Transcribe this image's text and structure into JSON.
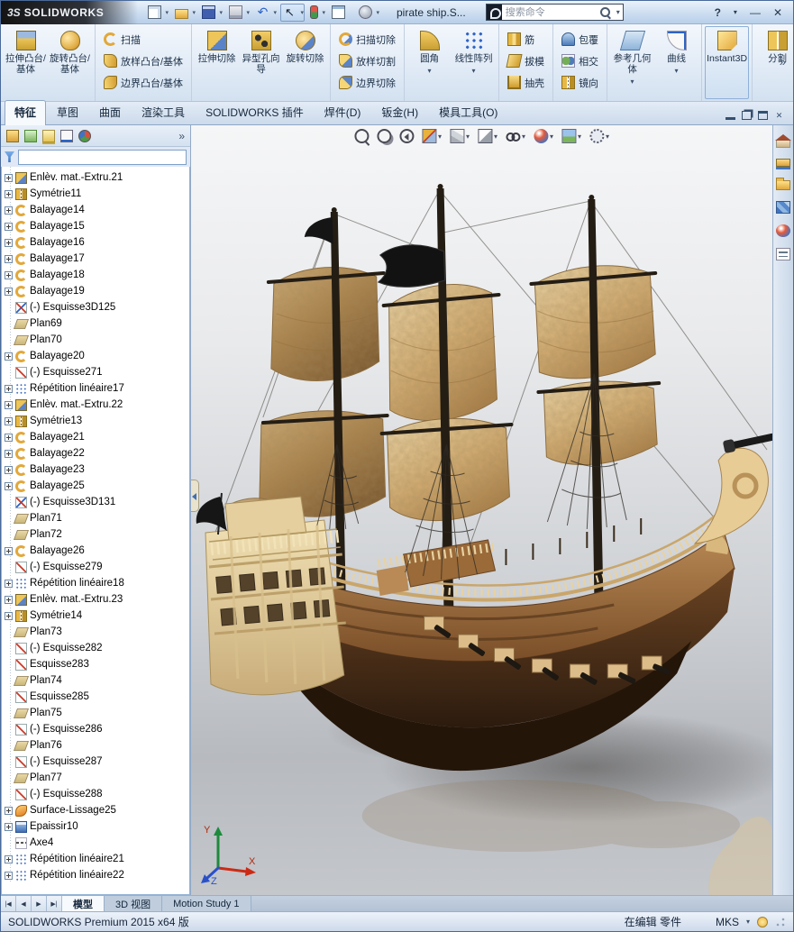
{
  "window": {
    "logo_mark": "3S",
    "logo_text": "SOLIDWORKS",
    "doc_name": "pirate ship.S...",
    "search_placeholder": "搜索命令",
    "help": "?",
    "help_chevron": "▾",
    "minimize": "—",
    "close": "✕"
  },
  "titlebar": {
    "tools": [
      {
        "name": "new-document-icon",
        "icon": "newdoc",
        "dropdown": true
      },
      {
        "name": "open-icon",
        "icon": "open",
        "dropdown": true
      },
      {
        "name": "save-icon",
        "icon": "save",
        "dropdown": true
      },
      {
        "name": "print-icon",
        "icon": "print",
        "dropdown": true
      },
      {
        "name": "undo-icon",
        "icon": "undo",
        "dropdown": true
      },
      {
        "name": "select-icon",
        "icon": "select",
        "dropdown": true,
        "active": true
      },
      {
        "name": "rebuild-icon",
        "icon": "rebuild",
        "dropdown": true
      },
      {
        "name": "file-properties-icon",
        "icon": "fileprops"
      },
      {
        "name": "options-icon",
        "icon": "options",
        "dropdown": true
      }
    ]
  },
  "ribbon": {
    "overflow": "»",
    "sections": [
      {
        "layout": "large",
        "items": [
          {
            "label": "拉伸凸台/基体",
            "icon": "extrude"
          },
          {
            "label": "旋转凸台/基体",
            "icon": "revolve"
          }
        ]
      },
      {
        "layout": "stack",
        "items": [
          {
            "label": "扫描",
            "icon": "sweep"
          },
          {
            "label": "放样凸台/基体",
            "icon": "loft"
          },
          {
            "label": "边界凸台/基体",
            "icon": "boundary"
          }
        ]
      },
      {
        "layout": "large",
        "items": [
          {
            "label": "拉伸切除",
            "icon": "cut-extrude"
          },
          {
            "label": "异型孔向导",
            "icon": "holewiz"
          },
          {
            "label": "旋转切除",
            "icon": "cut-revolve"
          }
        ]
      },
      {
        "layout": "stack",
        "items": [
          {
            "label": "扫描切除",
            "icon": "cut-sweep"
          },
          {
            "label": "放样切割",
            "icon": "cut-loft"
          },
          {
            "label": "边界切除",
            "icon": "cut-boundary"
          }
        ]
      },
      {
        "layout": "large",
        "items": [
          {
            "label": "圆角",
            "icon": "fillet",
            "dropdown": true
          },
          {
            "label": "线性阵列",
            "icon": "linpat",
            "dropdown": true
          }
        ]
      },
      {
        "layout": "stack",
        "items": [
          {
            "label": "筋",
            "icon": "rib"
          },
          {
            "label": "拔模",
            "icon": "draft"
          },
          {
            "label": "抽壳",
            "icon": "shell"
          }
        ]
      },
      {
        "layout": "stack",
        "items": [
          {
            "label": "包覆",
            "icon": "wrap"
          },
          {
            "label": "相交",
            "icon": "intersect"
          },
          {
            "label": "镜向",
            "icon": "mirror-f"
          }
        ]
      },
      {
        "layout": "large",
        "items": [
          {
            "label": "参考几何体",
            "icon": "refgeo",
            "dropdown": true
          },
          {
            "label": "曲线",
            "icon": "curves",
            "dropdown": true
          }
        ]
      },
      {
        "layout": "large",
        "items": [
          {
            "label": "Instant3D",
            "icon": "instant3d",
            "active": true
          }
        ]
      },
      {
        "layout": "large",
        "items": [
          {
            "label": "分割",
            "icon": "split"
          }
        ]
      }
    ]
  },
  "cmd_tabs": [
    {
      "label": "特征",
      "active": true
    },
    {
      "label": "草图"
    },
    {
      "label": "曲面"
    },
    {
      "label": "渲染工具"
    },
    {
      "label": "SOLIDWORKS 插件"
    },
    {
      "label": "焊件(D)"
    },
    {
      "label": "钣金(H)"
    },
    {
      "label": "模具工具(O)"
    }
  ],
  "docwin": {
    "icons": [
      {
        "name": "doc-minimize-icon",
        "icon": "wmin"
      },
      {
        "name": "doc-restore-icon",
        "icon": "wrest"
      },
      {
        "name": "doc-maximize-icon",
        "icon": "wmax"
      },
      {
        "name": "doc-close-icon",
        "icon": "wclose"
      }
    ]
  },
  "panel": {
    "overflow": "»",
    "filter_value": "",
    "tabs": [
      {
        "name": "featuremanager-tab-icon",
        "icon": "fm"
      },
      {
        "name": "propertymanager-tab-icon",
        "icon": "pm"
      },
      {
        "name": "configurationmanager-tab-icon",
        "icon": "cm"
      },
      {
        "name": "dimxpertmanager-tab-icon",
        "icon": "dx"
      },
      {
        "name": "displaymanager-tab-icon",
        "icon": "dm"
      }
    ]
  },
  "tree": {
    "items": [
      {
        "label": "Enlèv. mat.-Extru.21",
        "icon": "cut-extrude",
        "exp": true
      },
      {
        "label": "Symétrie11",
        "icon": "mirror-f",
        "exp": true
      },
      {
        "label": "Balayage14",
        "icon": "sweep",
        "exp": true
      },
      {
        "label": "Balayage15",
        "icon": "sweep",
        "exp": true
      },
      {
        "label": "Balayage16",
        "icon": "sweep",
        "exp": true
      },
      {
        "label": "Balayage17",
        "icon": "sweep",
        "exp": true
      },
      {
        "label": "Balayage18",
        "icon": "sweep",
        "exp": true
      },
      {
        "label": "Balayage19",
        "icon": "sweep",
        "exp": true
      },
      {
        "label": "(-) Esquisse3D125",
        "icon": "sketch3d",
        "exp": false
      },
      {
        "label": "Plan69",
        "icon": "plane",
        "exp": false
      },
      {
        "label": "Plan70",
        "icon": "plane",
        "exp": false
      },
      {
        "label": "Balayage20",
        "icon": "sweep",
        "exp": true
      },
      {
        "label": "(-) Esquisse271",
        "icon": "sketch",
        "exp": false
      },
      {
        "label": "Répétition linéaire17",
        "icon": "linpat",
        "exp": true
      },
      {
        "label": "Enlèv. mat.-Extru.22",
        "icon": "cut-extrude",
        "exp": true
      },
      {
        "label": "Symétrie13",
        "icon": "mirror-f",
        "exp": true
      },
      {
        "label": "Balayage21",
        "icon": "sweep",
        "exp": true
      },
      {
        "label": "Balayage22",
        "icon": "sweep",
        "exp": true
      },
      {
        "label": "Balayage23",
        "icon": "sweep",
        "exp": true
      },
      {
        "label": "Balayage25",
        "icon": "sweep",
        "exp": true
      },
      {
        "label": "(-) Esquisse3D131",
        "icon": "sketch3d",
        "exp": false
      },
      {
        "label": "Plan71",
        "icon": "plane",
        "exp": false
      },
      {
        "label": "Plan72",
        "icon": "plane",
        "exp": false
      },
      {
        "label": "Balayage26",
        "icon": "sweep",
        "exp": true
      },
      {
        "label": "(-) Esquisse279",
        "icon": "sketch",
        "exp": false
      },
      {
        "label": "Répétition linéaire18",
        "icon": "linpat",
        "exp": true
      },
      {
        "label": "Enlèv. mat.-Extru.23",
        "icon": "cut-extrude",
        "exp": true
      },
      {
        "label": "Symétrie14",
        "icon": "mirror-f",
        "exp": true
      },
      {
        "label": "Plan73",
        "icon": "plane",
        "exp": false
      },
      {
        "label": "(-) Esquisse282",
        "icon": "sketch",
        "exp": false
      },
      {
        "label": "Esquisse283",
        "icon": "sketch",
        "exp": false
      },
      {
        "label": "Plan74",
        "icon": "plane",
        "exp": false
      },
      {
        "label": "Esquisse285",
        "icon": "sketch",
        "exp": false
      },
      {
        "label": "Plan75",
        "icon": "plane",
        "exp": false
      },
      {
        "label": "(-) Esquisse286",
        "icon": "sketch",
        "exp": false
      },
      {
        "label": "Plan76",
        "icon": "plane",
        "exp": false
      },
      {
        "label": "(-) Esquisse287",
        "icon": "sketch",
        "exp": false
      },
      {
        "label": "Plan77",
        "icon": "plane",
        "exp": false
      },
      {
        "label": "(-) Esquisse288",
        "icon": "sketch",
        "exp": false
      },
      {
        "label": "Surface-Lissage25",
        "icon": "surfloft",
        "exp": true
      },
      {
        "label": "Epaissir10",
        "icon": "thicken",
        "exp": true
      },
      {
        "label": "Axe4",
        "icon": "axis",
        "exp": false
      },
      {
        "label": "Répétition linéaire21",
        "icon": "linpat",
        "exp": true
      },
      {
        "label": "Répétition linéaire22",
        "icon": "linpat",
        "exp": true
      }
    ]
  },
  "hud": {
    "icons": [
      {
        "name": "zoom-fit-icon",
        "icon": "zoomfit"
      },
      {
        "name": "zoom-area-icon",
        "icon": "zoomarea"
      },
      {
        "name": "previous-view-icon",
        "icon": "prevview"
      },
      {
        "name": "section-view-icon",
        "icon": "section",
        "dropdown": true
      },
      {
        "name": "view-orientation-icon",
        "icon": "viewcube",
        "dropdown": true
      },
      {
        "name": "display-style-icon",
        "icon": "dispstyle",
        "dropdown": true
      },
      {
        "name": "hide-show-items-icon",
        "icon": "glasses",
        "dropdown": true
      },
      {
        "name": "edit-appearance-icon",
        "icon": "ball",
        "dropdown": true
      },
      {
        "name": "apply-scene-icon",
        "icon": "scene",
        "dropdown": true
      },
      {
        "name": "view-settings-icon",
        "icon": "viewset",
        "dropdown": true
      }
    ]
  },
  "taskpane": {
    "icons": [
      {
        "name": "solidworks-resources-icon",
        "icon": "home"
      },
      {
        "name": "design-library-icon",
        "icon": "designlib"
      },
      {
        "name": "file-explorer-icon",
        "icon": "folder"
      },
      {
        "name": "view-palette-icon",
        "icon": "palette"
      },
      {
        "name": "appearances-icon",
        "icon": "ball"
      },
      {
        "name": "custom-properties-icon",
        "icon": "props"
      }
    ]
  },
  "viewport": {
    "triad": {
      "x": "X",
      "y": "Y",
      "z": "Z"
    }
  },
  "bottom": {
    "nav": [
      "|◀",
      "◀",
      "▶",
      "▶|"
    ],
    "tabs": [
      {
        "label": "模型",
        "active": true
      },
      {
        "label": "3D 视图"
      },
      {
        "label": "Motion Study 1"
      }
    ]
  },
  "statusbar": {
    "app_version": "SOLIDWORKS Premium 2015 x64 版",
    "edit_state": "在编辑 零件",
    "units": "MKS",
    "icons": [
      {
        "name": "quick-tips-icon",
        "icon": "qtip"
      }
    ]
  }
}
